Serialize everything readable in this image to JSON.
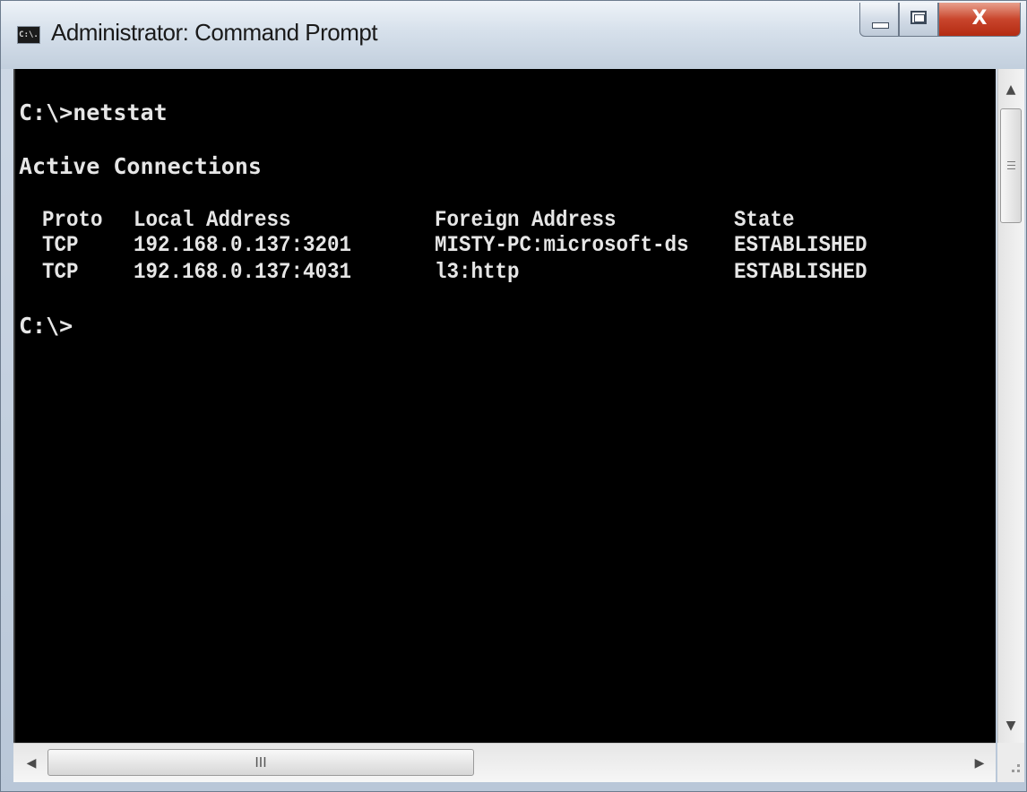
{
  "window": {
    "title": "Administrator: Command Prompt",
    "icon_text": "C:\\.",
    "close_glyph": "X"
  },
  "console": {
    "prompt_command": "C:\\>netstat",
    "heading": "Active Connections",
    "columns": [
      "Proto",
      "Local Address",
      "Foreign Address",
      "State"
    ],
    "rows": [
      [
        "TCP",
        "192.168.0.137:3201",
        "MISTY-PC:microsoft-ds",
        "ESTABLISHED"
      ],
      [
        "TCP",
        "192.168.0.137:4031",
        "l3:http",
        "ESTABLISHED"
      ]
    ],
    "prompt_end": "C:\\>"
  },
  "scrollbar": {
    "up_arrow": "▲",
    "down_arrow": "▼",
    "left_arrow": "◀",
    "right_arrow": "▶",
    "thumb_grip": "III"
  },
  "colors": {
    "console_bg": "#000000",
    "console_fg": "#e6e6e6",
    "close_button": "#c9452c"
  }
}
